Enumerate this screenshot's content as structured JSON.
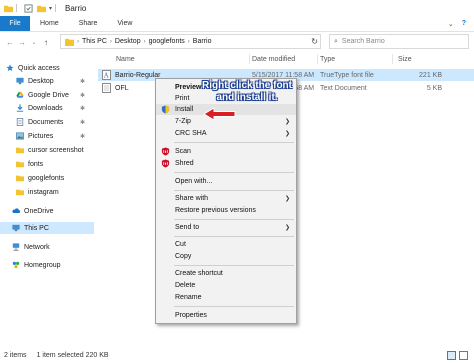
{
  "window": {
    "title": "Barrio"
  },
  "ribbon": {
    "tabs": [
      "File",
      "Home",
      "Share",
      "View"
    ],
    "icons": [
      "chevron-down-icon",
      "help-icon"
    ]
  },
  "address": {
    "crumbs": [
      "This PC",
      "Desktop",
      "googlefonts",
      "Barrio"
    ],
    "search_placeholder": "Search Barrio"
  },
  "nav": {
    "items": [
      {
        "label": "Quick access",
        "icon": "star-icon"
      },
      {
        "label": "Desktop",
        "icon": "desktop-icon",
        "pinned": true
      },
      {
        "label": "Google Drive",
        "icon": "google-drive-icon",
        "pinned": true
      },
      {
        "label": "Downloads",
        "icon": "downloads-icon",
        "pinned": true
      },
      {
        "label": "Documents",
        "icon": "documents-icon",
        "pinned": true
      },
      {
        "label": "Pictures",
        "icon": "pictures-icon",
        "pinned": true
      },
      {
        "label": "cursor screenshot",
        "icon": "folder-icon"
      },
      {
        "label": "fonts",
        "icon": "folder-icon"
      },
      {
        "label": "googlefonts",
        "icon": "folder-icon"
      },
      {
        "label": "instagram",
        "icon": "folder-icon"
      },
      {
        "label": "OneDrive",
        "icon": "onedrive-icon"
      },
      {
        "label": "This PC",
        "icon": "this-pc-icon",
        "selected": true
      },
      {
        "label": "Network",
        "icon": "network-icon"
      },
      {
        "label": "Homegroup",
        "icon": "homegroup-icon"
      }
    ]
  },
  "files": {
    "columns": [
      "Name",
      "Date modified",
      "Type",
      "Size"
    ],
    "rows": [
      {
        "name": "Barrio-Regular",
        "date": "5/15/2017 11:58 AM",
        "type": "TrueType font file",
        "size": "221 KB",
        "selected": true
      },
      {
        "name": "OFL",
        "date": "5/15/2017 11:58 AM",
        "type": "Text Document",
        "size": "5 KB",
        "selected": false
      }
    ]
  },
  "context_menu": {
    "items": [
      {
        "label": "Preview",
        "bold": true
      },
      {
        "label": "Print"
      },
      {
        "label": "Install",
        "icon": "shield-icon",
        "hover": true
      },
      {
        "label": "7-Zip",
        "submenu": true
      },
      {
        "label": "CRC SHA",
        "submenu": true
      },
      {
        "label": "Scan",
        "icon": "mcafee-icon"
      },
      {
        "label": "Shred",
        "icon": "mcafee-icon"
      },
      {
        "label": "Open with..."
      },
      {
        "label": "Share with",
        "submenu": true
      },
      {
        "label": "Restore previous versions"
      },
      {
        "label": "Send to",
        "submenu": true
      },
      {
        "label": "Cut"
      },
      {
        "label": "Copy"
      },
      {
        "label": "Create shortcut"
      },
      {
        "label": "Delete"
      },
      {
        "label": "Rename"
      },
      {
        "label": "Properties"
      }
    ]
  },
  "annotation": {
    "text": "Right click the font and install it."
  },
  "status": {
    "item_count": "2 items",
    "selection": "1 item selected  220 KB"
  },
  "colors": {
    "accent": "#1979ca",
    "selection": "#cce8ff",
    "callout_outline": "#1c3e8f",
    "arrow": "#d91f26"
  }
}
